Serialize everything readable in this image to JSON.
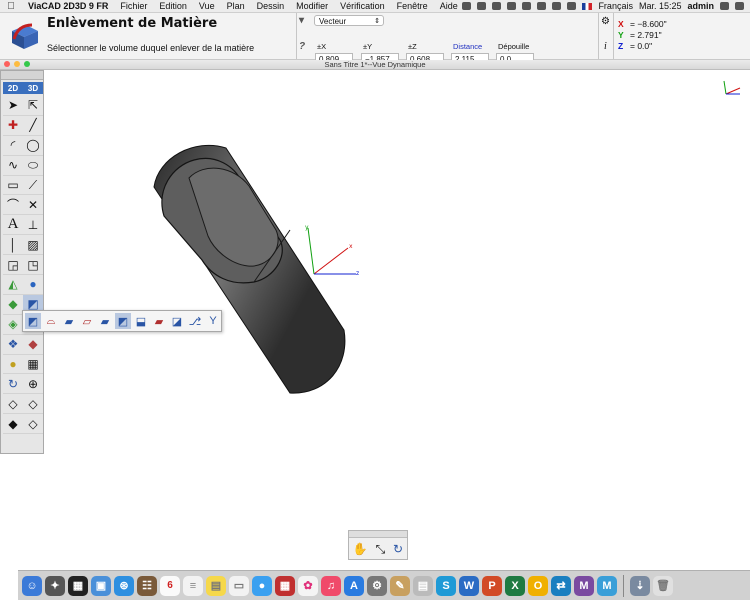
{
  "menubar": {
    "app_name": "ViaCAD 2D3D 9 FR",
    "items": [
      "Fichier",
      "Edition",
      "Vue",
      "Plan",
      "Dessin",
      "Modifier",
      "Vérification",
      "Fenêtre",
      "Aide"
    ],
    "input_source": "Français",
    "clock": "Mar. 15:25",
    "user": "admin"
  },
  "tool": {
    "title": "Enlèvement de Matière",
    "prompt": "Sélectionner le volume duquel enlever de la matière",
    "mode_select": "Vecteur",
    "fields": [
      {
        "label": "±X",
        "value": "0.809"
      },
      {
        "label": "±Y",
        "value": "−1.857"
      },
      {
        "label": "±Z",
        "value": "0.608"
      },
      {
        "label": "Distance",
        "value": "2.115"
      },
      {
        "label": "Dépouille",
        "value": "0.0"
      }
    ]
  },
  "coords": {
    "x_label": "X",
    "x": "−8.600\"",
    "y_label": "Y",
    "y": "2.791\"",
    "z_label": "Z",
    "z": "0.0\""
  },
  "window": {
    "title": "Sans Titre 1*--Vue Dynamique"
  },
  "palette": {
    "mode_2d": "2D",
    "mode_3d": "3D"
  },
  "axes": {
    "x": "x",
    "y": "y",
    "z": "z"
  },
  "dock": {
    "calendar_day": "6"
  },
  "colors": {
    "axis_x": "#d01010",
    "axis_y": "#10a010",
    "axis_z": "#1020d0",
    "palette_header": "#3a6fbe",
    "selection": "#b9c8e0"
  }
}
